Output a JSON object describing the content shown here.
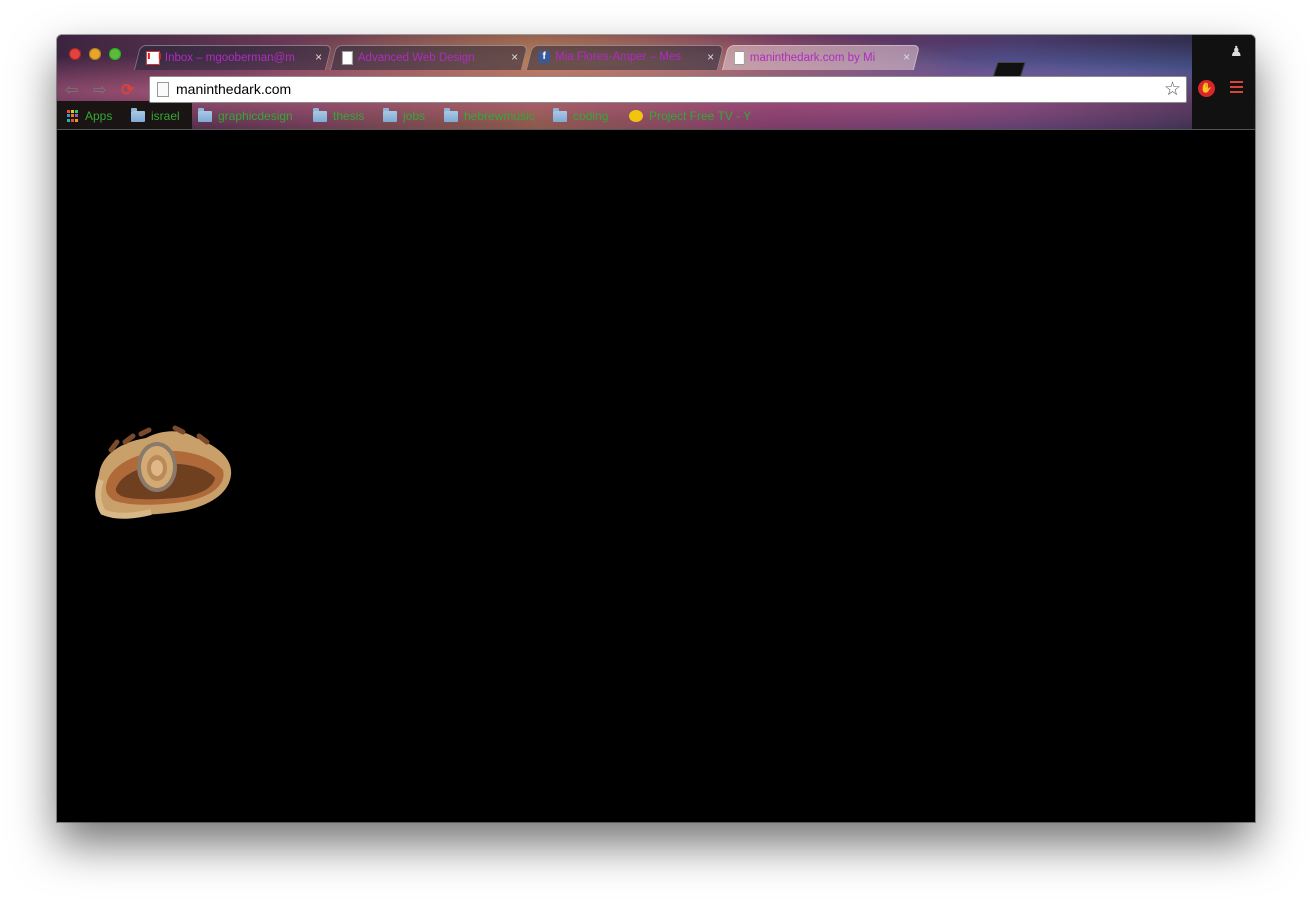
{
  "browser": {
    "tabs": [
      {
        "title": "Inbox – mgooberman@m",
        "favicon": "gmail-icon",
        "active": false
      },
      {
        "title": "Advanced Web Design",
        "favicon": "document-icon",
        "active": false
      },
      {
        "title": "Mia Flores-Amper – Mes",
        "favicon": "facebook-icon",
        "active": false
      },
      {
        "title": "maninthedark.com by Mi",
        "favicon": "document-icon",
        "active": true
      }
    ],
    "tab_close_glyph": "×",
    "address": {
      "url": "maninthedark.com"
    },
    "bookmarks": [
      {
        "label": "Apps",
        "icon": "apps-grid-icon"
      },
      {
        "label": "israel",
        "icon": "folder-icon"
      },
      {
        "label": "graphicdesign",
        "icon": "folder-icon"
      },
      {
        "label": "thesis",
        "icon": "folder-icon"
      },
      {
        "label": "jobs",
        "icon": "folder-icon"
      },
      {
        "label": "hebrewmusic",
        "icon": "folder-icon"
      },
      {
        "label": "coding",
        "icon": "folder-icon"
      },
      {
        "label": "Project Free TV - Y",
        "icon": "project-free-tv-icon"
      }
    ]
  },
  "colors": {
    "page_background": "#000000",
    "tab_text": "#b02bc2",
    "bookmark_text": "#35a835",
    "reload_and_menu": "#d8433a"
  }
}
